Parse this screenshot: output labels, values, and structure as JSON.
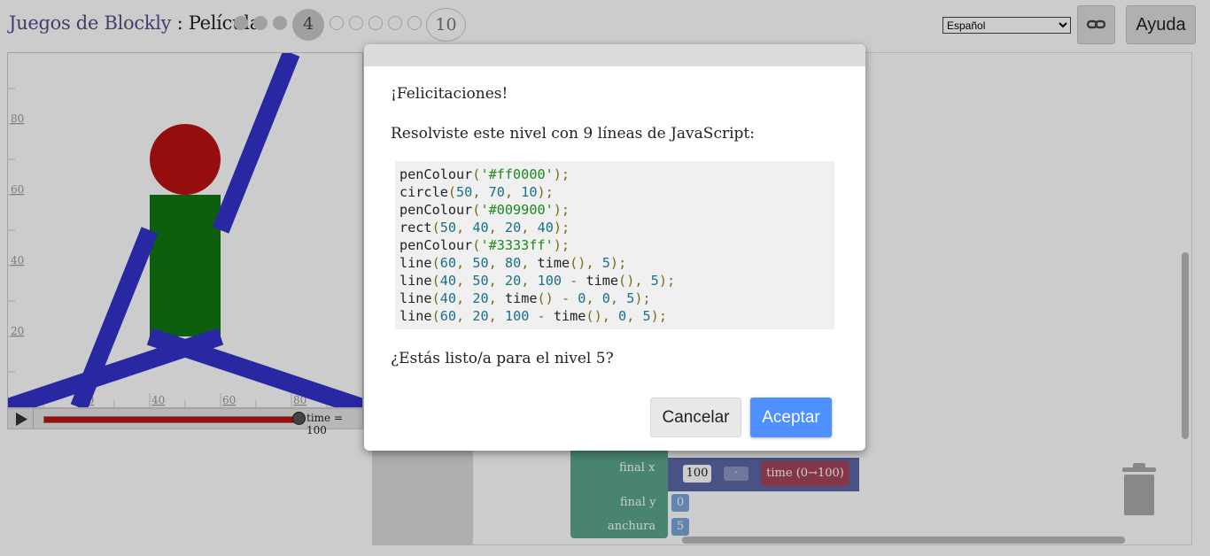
{
  "header": {
    "app_name": "Juegos de Blockly",
    "separator": " : ",
    "game_name": "Película",
    "current_level": "4",
    "last_level": "10",
    "language": "Español",
    "help_label": "Ayuda"
  },
  "visualization": {
    "y_ticks": [
      "80",
      "60",
      "40",
      "20"
    ],
    "x_ticks": [
      "20",
      "40",
      "60",
      "80"
    ],
    "time_label": "time = 100",
    "colors": {
      "head": "#bb1111",
      "body": "#117711",
      "limbs": "#3333cc"
    }
  },
  "workspace": {
    "labels": {
      "final_x": "final x",
      "final_y": "final y",
      "width": "anchura"
    },
    "values": {
      "x_number": "100",
      "operator": "-",
      "time_block": "time (0→100)",
      "y_value": "0",
      "width_value": "5"
    }
  },
  "dialog": {
    "congrats": "¡Felicitaciones!",
    "solved_text": "Resolviste este nivel con 9 líneas de JavaScript:",
    "code": [
      "penColour('#ff0000');",
      "circle(50, 70, 10);",
      "penColour('#009900');",
      "rect(50, 40, 20, 40);",
      "penColour('#3333ff');",
      "line(60, 50, 80, time(), 5);",
      "line(40, 50, 20, 100 - time(), 5);",
      "line(40, 20, time() - 0, 0, 5);",
      "line(60, 20, 100 - time(), 0, 5);"
    ],
    "question": "¿Estás listo/a para el nivel 5?",
    "cancel_label": "Cancelar",
    "accept_label": "Aceptar",
    "accent_color": "#4d90fe"
  }
}
